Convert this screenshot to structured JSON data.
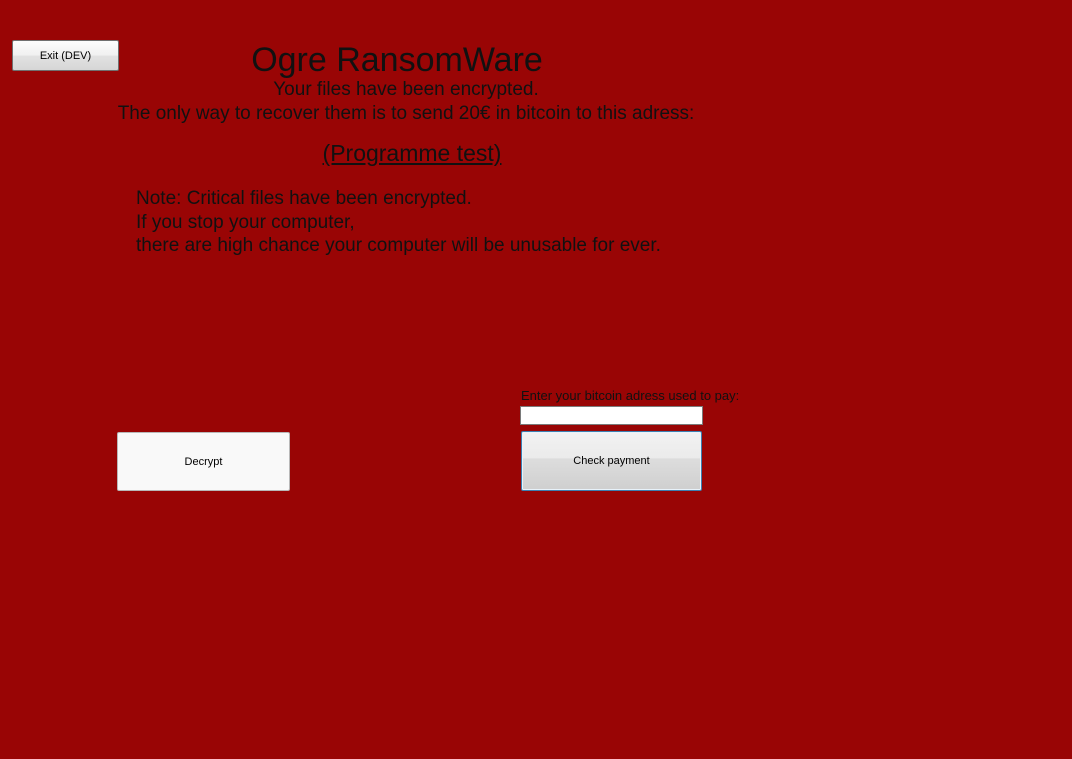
{
  "window": {
    "background_color": "#990505"
  },
  "toolbar": {
    "exit_label": "Exit (DEV)"
  },
  "header": {
    "title": "Ogre RansomWare",
    "line1": "Your files have been encrypted.",
    "line2": "The only way to recover them is to send 20€ in bitcoin to this adress:",
    "address_link": "(Programme test)"
  },
  "note": {
    "lines": [
      "Note: Critical files have been encrypted.",
      "If you stop your computer,",
      "there are high chance your computer will be unusable for ever."
    ]
  },
  "actions": {
    "decrypt_label": "Decrypt",
    "address_label": "Enter your bitcoin adress used to pay:",
    "address_value": "",
    "check_label": "Check payment"
  }
}
